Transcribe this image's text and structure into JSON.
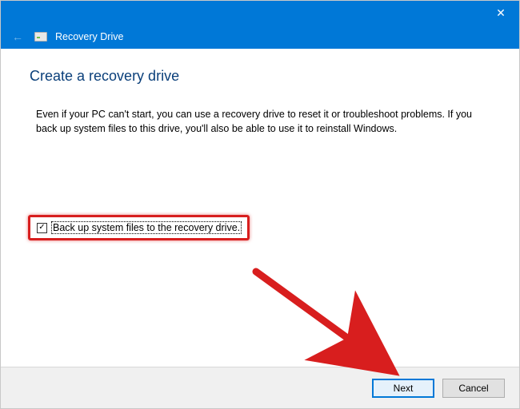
{
  "titlebar": {
    "close_glyph": "✕"
  },
  "subhead": {
    "title": "Recovery Drive",
    "back_glyph": "←"
  },
  "content": {
    "heading": "Create a recovery drive",
    "description": "Even if your PC can't start, you can use a recovery drive to reset it or troubleshoot problems. If you back up system files to this drive, you'll also be able to use it to reinstall Windows."
  },
  "checkbox": {
    "checked_glyph": "✓",
    "label": "Back up system files to the recovery drive."
  },
  "footer": {
    "next": "Next",
    "cancel": "Cancel"
  }
}
